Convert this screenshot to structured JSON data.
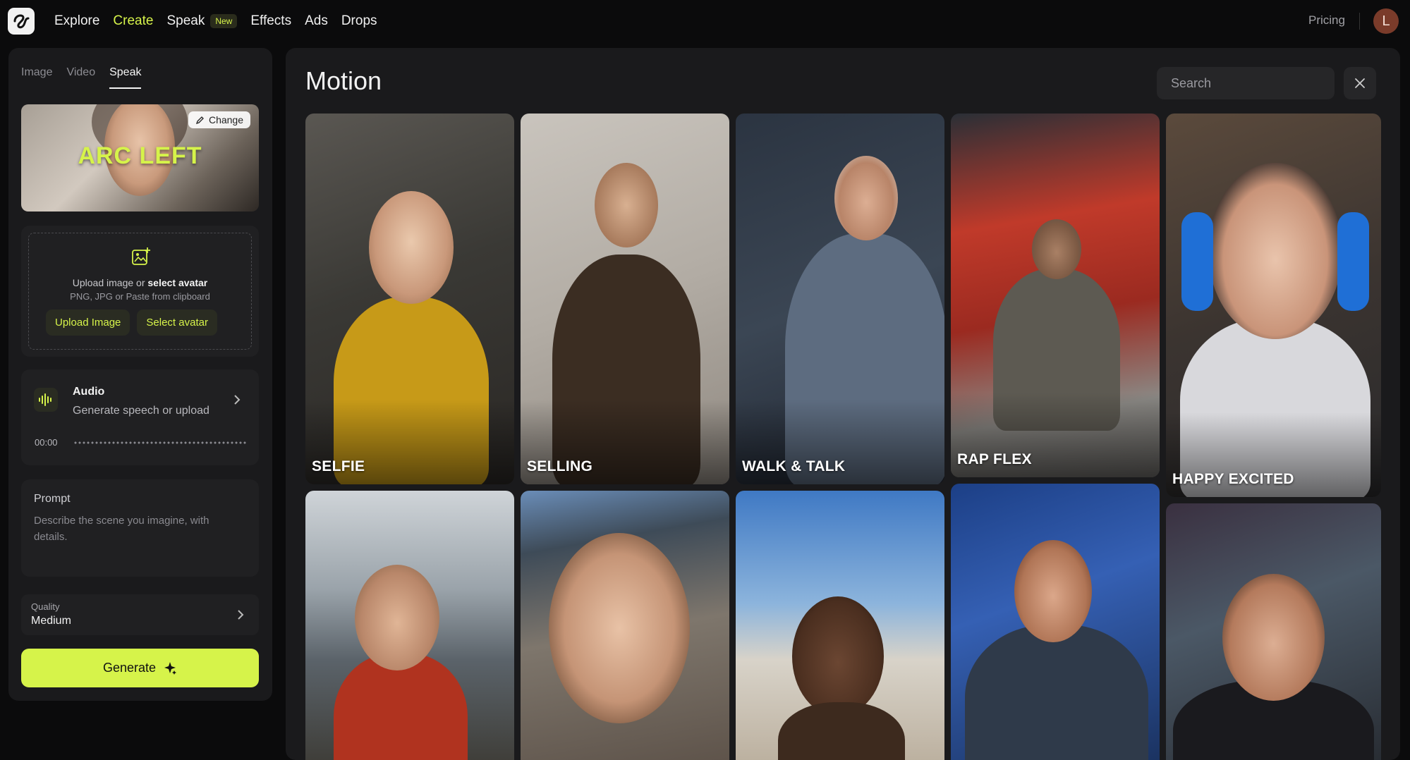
{
  "nav": {
    "links": [
      {
        "label": "Explore"
      },
      {
        "label": "Create"
      },
      {
        "label": "Speak"
      },
      {
        "label": "Effects"
      },
      {
        "label": "Ads"
      },
      {
        "label": "Drops"
      }
    ],
    "new_badge": "New",
    "pricing": "Pricing",
    "avatar_initial": "L",
    "active_link": "Create"
  },
  "left": {
    "tabs": [
      "Image",
      "Video",
      "Speak"
    ],
    "active_tab": "Speak",
    "preview_text": "ARC LEFT",
    "change_label": "Change",
    "upload": {
      "line1_prefix": "Upload image or ",
      "line1_bold": "select avatar",
      "line2": "PNG, JPG or Paste from clipboard",
      "upload_button": "Upload Image",
      "select_button": "Select avatar"
    },
    "audio": {
      "title": "Audio",
      "subtitle": "Generate speech or upload",
      "time": "00:00"
    },
    "prompt": {
      "title": "Prompt",
      "placeholder": "Describe the scene you imagine, with details."
    },
    "quality": {
      "label": "Quality",
      "value": "Medium"
    },
    "generate_label": "Generate"
  },
  "main": {
    "title": "Motion",
    "search_placeholder": "Search",
    "cards": [
      {
        "label": "SELFIE"
      },
      {
        "label": "SELLING"
      },
      {
        "label": "WALK & TALK"
      },
      {
        "label": "RAP FLEX"
      },
      {
        "label": "HAPPY EXCITED"
      },
      {
        "label": ""
      },
      {
        "label": ""
      },
      {
        "label": ""
      },
      {
        "label": ""
      },
      {
        "label": ""
      }
    ]
  },
  "colors": {
    "accent": "#d6f34a",
    "panel": "#1a1a1c",
    "background": "#0b0b0c"
  }
}
